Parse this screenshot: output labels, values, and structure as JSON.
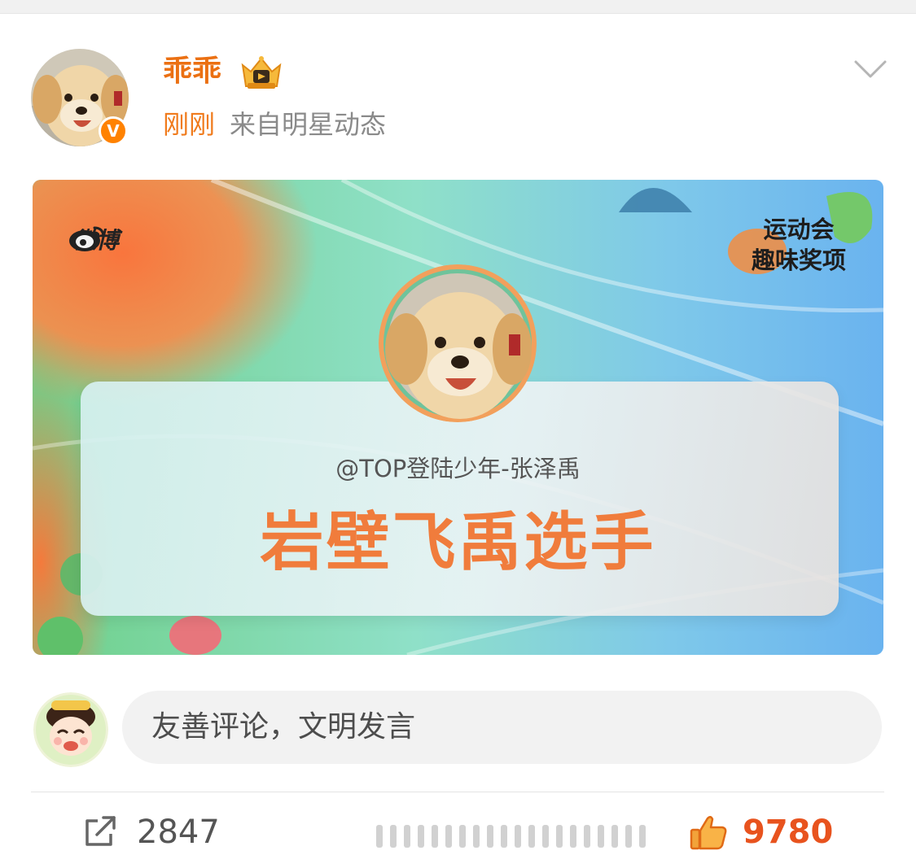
{
  "post": {
    "author_name": "乖乖",
    "verified_badge": "V",
    "time": "刚刚",
    "source": "来自明星动态",
    "crown_icon": "crown-vip-icon",
    "menu_icon": "chevron-down-icon"
  },
  "card": {
    "logo_text": "微博",
    "event_line1": "运动会",
    "event_line2": "趣味奖项",
    "handle": "@TOP登陆少年-张泽禹",
    "award_title": "岩壁飞禹选手"
  },
  "comment": {
    "placeholder": "友善评论，文明发言"
  },
  "actions": {
    "share_count": "2847",
    "like_count": "9780"
  },
  "colors": {
    "brand_orange": "#eb7012",
    "like_red": "#e8531e",
    "award_orange": "#f07c3c"
  }
}
